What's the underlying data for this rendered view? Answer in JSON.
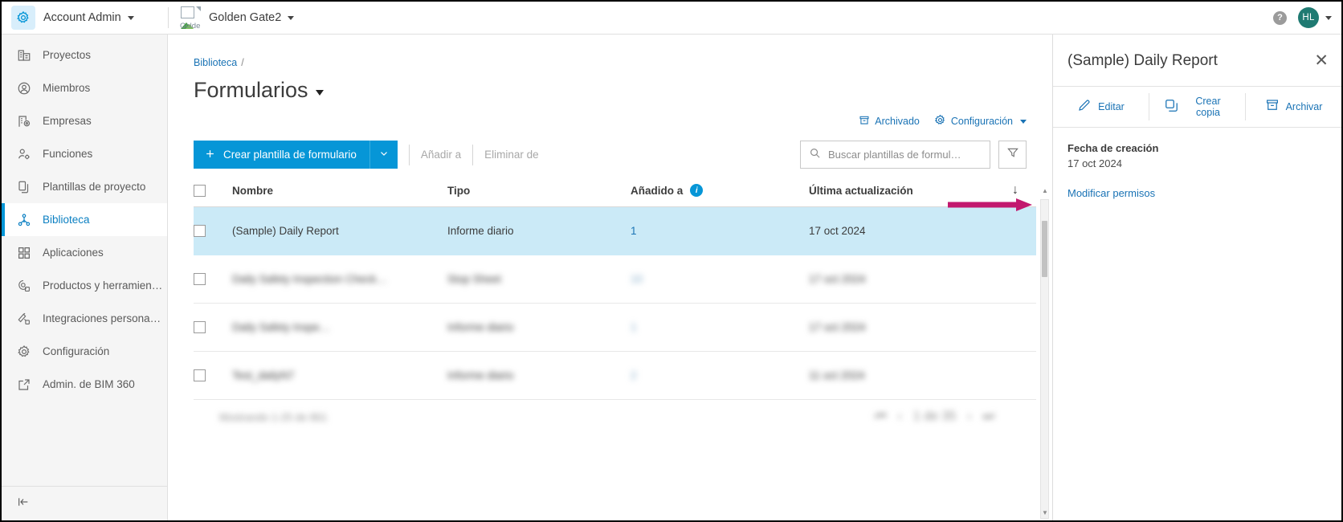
{
  "topbar": {
    "gear_icon": "gear-icon",
    "account_label": "Account Admin",
    "project_thumb_alt": "Golde",
    "project_label": "Golden Gate2",
    "help_icon": "?",
    "avatar_initials": "HL"
  },
  "sidebar": {
    "items": [
      {
        "label": "Proyectos",
        "icon": "buildings-icon",
        "active": false
      },
      {
        "label": "Miembros",
        "icon": "person-circle-icon",
        "active": false
      },
      {
        "label": "Empresas",
        "icon": "company-pin-icon",
        "active": false
      },
      {
        "label": "Funciones",
        "icon": "person-gear-icon",
        "active": false
      },
      {
        "label": "Plantillas de proyecto",
        "icon": "copy-icon",
        "active": false
      },
      {
        "label": "Biblioteca",
        "icon": "library-node-icon",
        "active": true
      },
      {
        "label": "Aplicaciones",
        "icon": "grid-squares-icon",
        "active": false
      },
      {
        "label": "Productos y herramien…",
        "icon": "products-tools-icon",
        "active": false
      },
      {
        "label": "Integraciones persona…",
        "icon": "custom-integrations-icon",
        "active": false
      },
      {
        "label": "Configuración",
        "icon": "gear-icon",
        "active": false
      },
      {
        "label": "Admin. de BIM 360",
        "icon": "external-link-icon",
        "active": false
      }
    ],
    "collapse_icon": "collapse-sidebar-icon"
  },
  "breadcrumb": {
    "root": "Biblioteca",
    "separator": "/"
  },
  "page": {
    "title": "Formularios"
  },
  "utility": {
    "archived_label": "Archivado",
    "archived_icon": "archive-icon",
    "settings_label": "Configuración",
    "settings_icon": "gear-icon"
  },
  "toolbar": {
    "create_label": "Crear plantilla de formulario",
    "create_icon": "plus-icon",
    "split_icon": "chevron-down-icon",
    "add_to_label": "Añadir a",
    "remove_from_label": "Eliminar de",
    "search_placeholder": "Buscar plantillas de formul…",
    "search_value": "",
    "search_icon": "search-icon",
    "filter_icon": "filter-funnel-icon"
  },
  "table": {
    "columns": [
      {
        "key": "name",
        "label": "Nombre"
      },
      {
        "key": "type",
        "label": "Tipo"
      },
      {
        "key": "added",
        "label": "Añadido a",
        "info_icon": "info-icon"
      },
      {
        "key": "updated",
        "label": "Última actualización",
        "sort_icon": "↓"
      }
    ],
    "rows": [
      {
        "name": "(Sample) Daily Report",
        "type": "Informe diario",
        "added": "1",
        "updated": "17 oct 2024",
        "selected": true,
        "blurred": false
      },
      {
        "name": "Daily Safety Inspection Check…",
        "type": "Stop Sheet",
        "added": "10",
        "updated": "17 oct 2024",
        "selected": false,
        "blurred": true
      },
      {
        "name": "Daily Safety Inspe…",
        "type": "Informe diario",
        "added": "1",
        "updated": "17 oct 2024",
        "selected": false,
        "blurred": true
      },
      {
        "name": "Test_dailyN7",
        "type": "Informe diario",
        "added": "2",
        "updated": "11 oct 2024",
        "selected": false,
        "blurred": true
      }
    ],
    "footer_text": "Mostrando 1-25 de 861"
  },
  "panel": {
    "title": "(Sample) Daily Report",
    "close_icon": "close-icon",
    "actions": [
      {
        "label": "Editar",
        "icon": "pencil-icon"
      },
      {
        "label": "Crear copia",
        "icon": "copy-icon"
      },
      {
        "label": "Archivar",
        "icon": "archive-icon"
      }
    ],
    "created_label": "Fecha de creación",
    "created_value": "17 oct 2024",
    "permissions_link": "Modificar permisos"
  },
  "annotation": {
    "arrow_color": "#c2186e",
    "arrow_target": "Modificar permisos"
  }
}
